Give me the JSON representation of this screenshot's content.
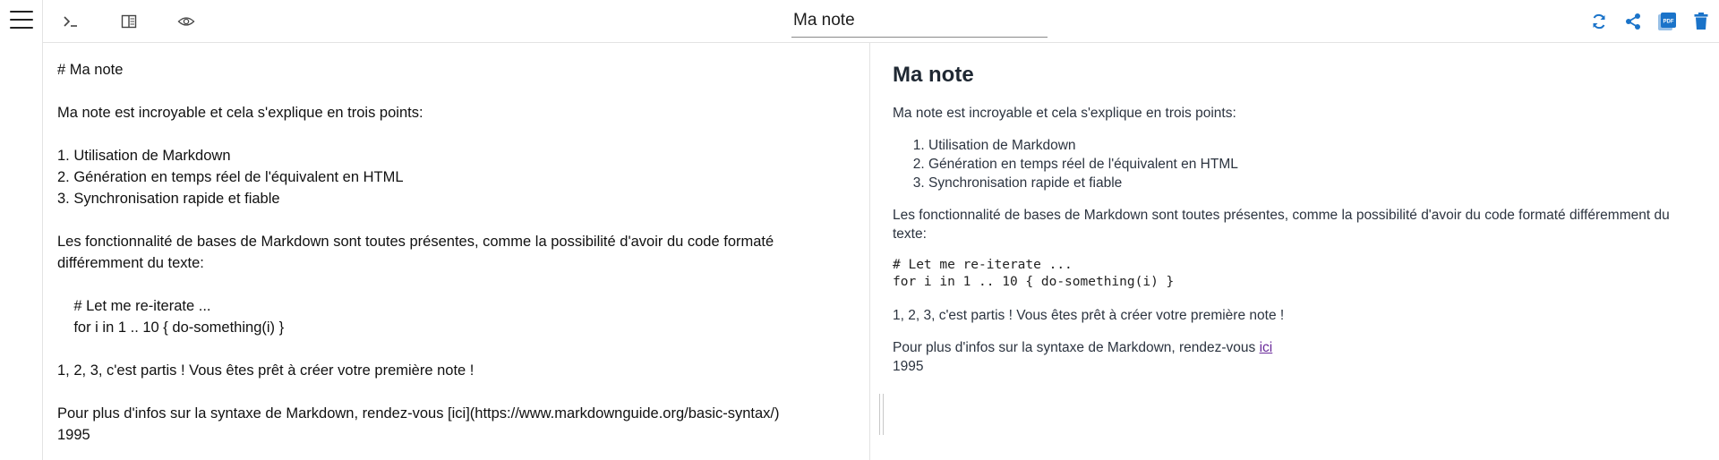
{
  "header": {
    "note_title": "Ma note"
  },
  "toolbar": {
    "menu_icon": "hamburger-menu-icon",
    "editor_only_icon": "terminal-prompt-icon",
    "split_view_icon": "split-view-icon",
    "preview_only_icon": "eye-icon",
    "sync_icon": "sync-icon",
    "share_icon": "share-icon",
    "pdf_icon": "pdf-icon",
    "pdf_label": "PDF",
    "delete_icon": "trash-icon",
    "accent_color": "#1a73c9"
  },
  "editor": {
    "lines": [
      "# Ma note",
      "",
      "Ma note est incroyable et cela s'explique en trois points:",
      "",
      "1. Utilisation de Markdown",
      "2. Génération en temps réel de l'équivalent en HTML",
      "3. Synchronisation rapide et fiable",
      "",
      "Les fonctionnalité de bases de Markdown sont toutes présentes, comme la possibilité d'avoir du code formaté",
      "différemment du texte:",
      "",
      "    # Let me re-iterate ...",
      "    for i in 1 .. 10 { do-something(i) }",
      "",
      "1, 2, 3, c'est partis ! Vous êtes prêt à créer votre première note !",
      "",
      "Pour plus d'infos sur la syntaxe de Markdown, rendez-vous [ici](https://www.markdownguide.org/basic-syntax/)",
      "1995"
    ]
  },
  "preview": {
    "heading": "Ma note",
    "intro": "Ma note est incroyable et cela s'explique en trois points:",
    "list": [
      "Utilisation de Markdown",
      "Génération en temps réel de l'équivalent en HTML",
      "Synchronisation rapide et fiable"
    ],
    "features": "Les fonctionnalité de bases de Markdown sont toutes présentes, comme la possibilité d'avoir du code formaté différemment du texte:",
    "code_line_1": "# Let me re-iterate ...",
    "code_line_2": "for i in 1 .. 10 { do-something(i) }",
    "ready": "1, 2, 3, c'est partis ! Vous êtes prêt à créer votre première note !",
    "more_prefix": "Pour plus d'infos sur la syntaxe de Markdown, rendez-vous ",
    "more_link": "ici",
    "year": "1995"
  }
}
